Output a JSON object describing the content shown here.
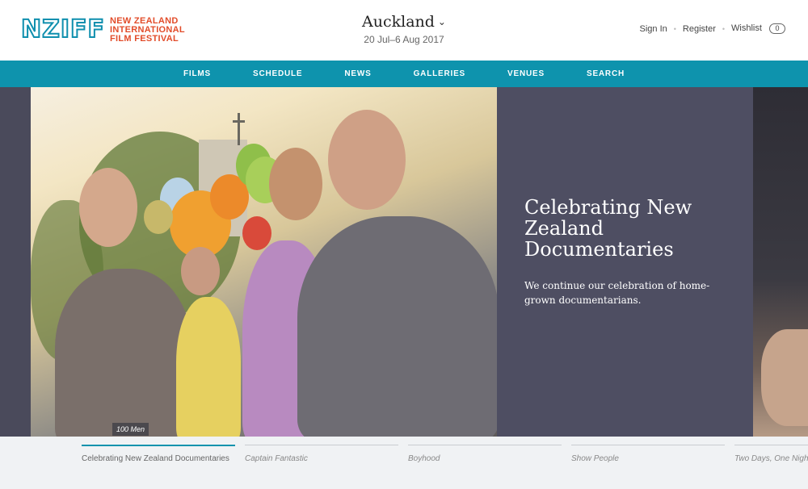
{
  "header": {
    "logo": {
      "mark": "NZIFF",
      "lines": [
        "NEW ZEALAND",
        "INTERNATIONAL",
        "FILM FESTIVAL"
      ]
    },
    "city": {
      "name": "Auckland",
      "dates": "20 Jul–6 Aug 2017",
      "chevron_icon": "chevron-down-icon"
    },
    "account": {
      "sign_in": "Sign In",
      "register": "Register",
      "wishlist": "Wishlist",
      "wishlist_count": "0"
    }
  },
  "nav": {
    "items": [
      "FILMS",
      "SCHEDULE",
      "NEWS",
      "GALLERIES",
      "VENUES",
      "SEARCH"
    ]
  },
  "hero": {
    "title": "Celebrating New Zealand Documentaries",
    "subtitle": "We continue our celebration of home-grown documentarians.",
    "photo_caption": "100 Men"
  },
  "slides": [
    {
      "label": "Celebrating New Zealand Documentaries",
      "active": true
    },
    {
      "label": "Captain Fantastic",
      "active": false
    },
    {
      "label": "Boyhood",
      "active": false
    },
    {
      "label": "Show People",
      "active": false
    },
    {
      "label": "Two Days, One Night",
      "active": false
    }
  ],
  "colors": {
    "accent": "#0e93ad",
    "logo_red": "#e24c2a",
    "hero_panel": "#4e4e62"
  }
}
